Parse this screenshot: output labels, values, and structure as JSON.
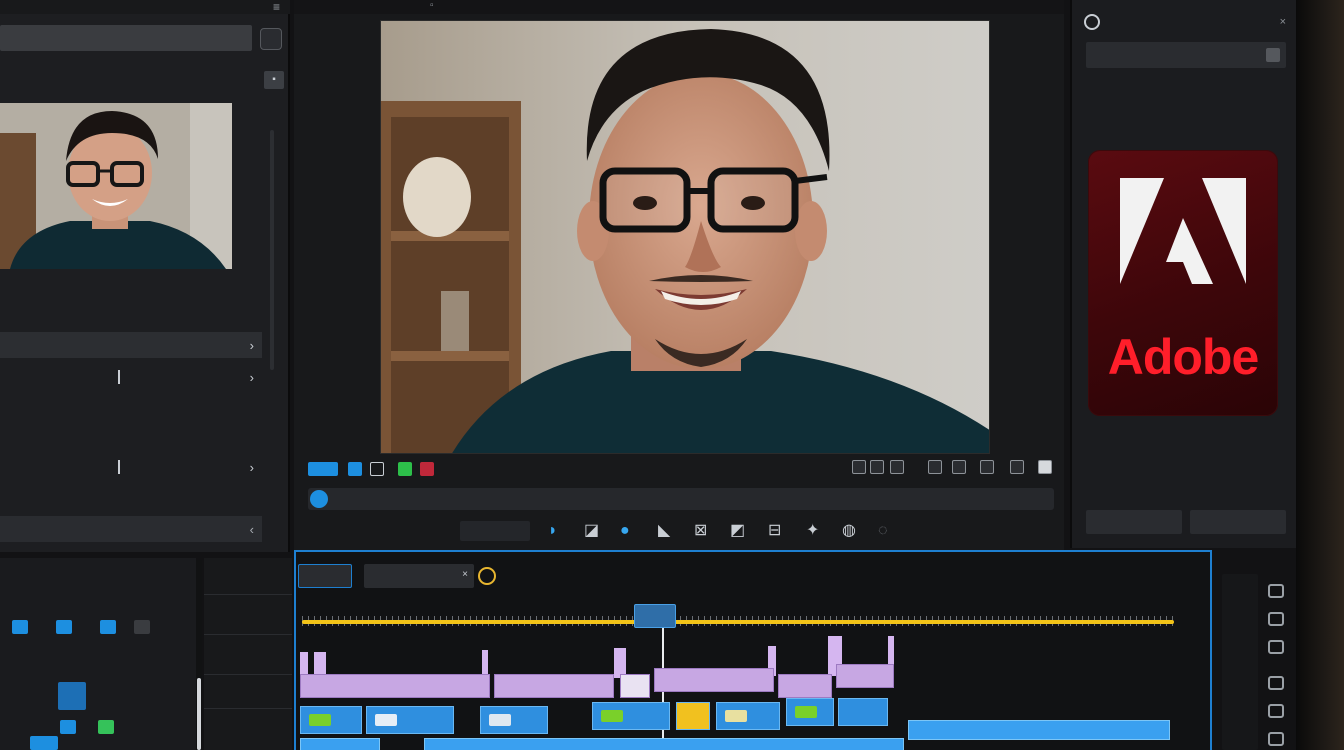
{
  "left_panel": {
    "search_value": "",
    "section_label": "",
    "meta": [
      "",
      "",
      ""
    ],
    "rows": [
      "",
      "",
      "",
      "",
      "",
      ""
    ],
    "footer_label": ""
  },
  "monitor": {
    "tab_label": "",
    "timecode_field": ""
  },
  "right_panel": {
    "header": "",
    "field": "",
    "brand_word": "Adobe",
    "bottom_field_1": "",
    "bottom_field_2": ""
  },
  "effects_panel": {
    "title": "",
    "title_right": "",
    "subtitle": ""
  },
  "track_header": {
    "title": ""
  },
  "timeline": {
    "active_tab": "",
    "sequence_tab": "",
    "ruler_labels": [
      "",
      "",
      "",
      "",
      "",
      "",
      "",
      "",
      "",
      ""
    ],
    "playhead_label": ""
  },
  "colors": {
    "accent": "#1d8fe0",
    "work_area": "#f2c318",
    "video_clip": "#c7a7e3",
    "audio_clip": "#2f8fdf",
    "brand_red": "#ff1e2a"
  },
  "icons": [
    "menu-icon",
    "search-icon",
    "chevron-right-icon",
    "play-icon",
    "mark-in-icon",
    "mark-out-icon",
    "lift-icon",
    "extract-icon",
    "export-frame-icon",
    "settings-icon",
    "target-icon",
    "close-icon"
  ]
}
